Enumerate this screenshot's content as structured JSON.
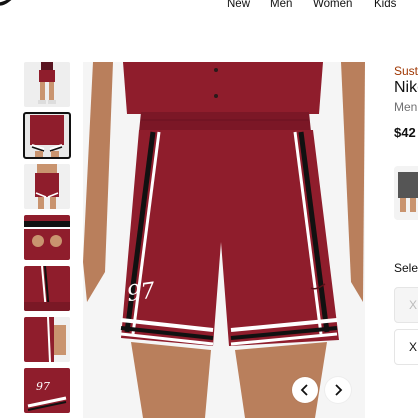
{
  "nav": {
    "logo": "swoosh-logo",
    "links": [
      "New",
      "Men",
      "Women",
      "Kids"
    ]
  },
  "product": {
    "badge": "Sust",
    "title": "Nike",
    "subtitle": "Men",
    "price": "$42",
    "color": "#8f1d2c",
    "jersey_number": "97"
  },
  "sizes": {
    "label": "Sele",
    "options": [
      "X",
      "X"
    ]
  },
  "carousel": {
    "prev_icon": "chevron-left-icon",
    "next_icon": "chevron-right-icon"
  }
}
